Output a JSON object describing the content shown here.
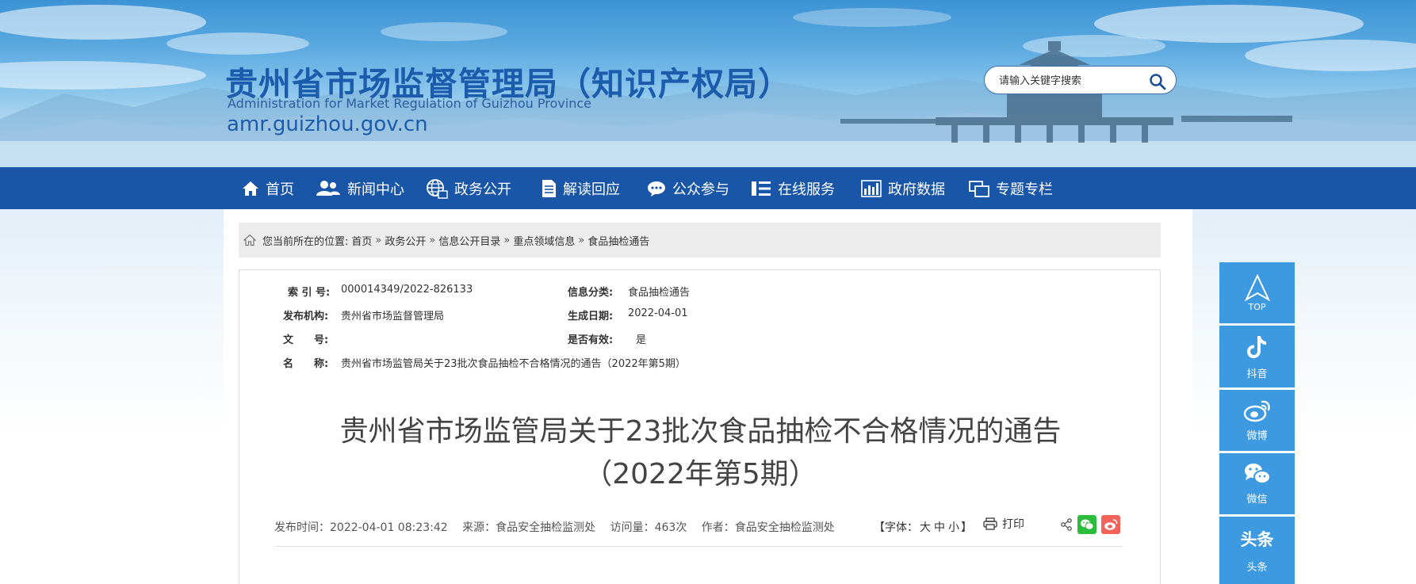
{
  "header": {
    "title": "贵州省市场监督管理局（知识产权局）",
    "subtitle": "Administration for Market Regulation of Guizhou Province",
    "domain": "amr.guizhou.gov.cn",
    "search_placeholder": "请输入关键字搜索",
    "search_icon": "search-icon"
  },
  "nav": {
    "items": [
      {
        "label": "首页",
        "icon": "home-icon"
      },
      {
        "label": "新闻中心",
        "icon": "people-icon"
      },
      {
        "label": "政务公开",
        "icon": "globe-icon"
      },
      {
        "label": "解读回应",
        "icon": "document-icon"
      },
      {
        "label": "公众参与",
        "icon": "chat-icon"
      },
      {
        "label": "在线服务",
        "icon": "list-icon"
      },
      {
        "label": "政府数据",
        "icon": "bar-chart-icon"
      },
      {
        "label": "专题专栏",
        "icon": "window-icon"
      }
    ],
    "bg_color": "#1a56a8"
  },
  "breadcrumb": {
    "prefix": "您当前所在的位置:",
    "items": [
      "首页",
      "政务公开",
      "信息公开目录",
      "重点领域信息",
      "食品抽检通告"
    ],
    "separator": "»"
  },
  "meta": {
    "index_label": "索 引 号:",
    "index_value": "000014349/2022-826133",
    "category_label": "信息分类:",
    "category_value": "食品抽检通告",
    "publisher_label": "发布机构:",
    "publisher_value": "贵州省市场监督管理局",
    "date_label": "生成日期:",
    "date_value": "2022-04-01",
    "docno_label": "文　　号:",
    "docno_value": "",
    "valid_label": "是否有效:",
    "valid_value": "是",
    "name_label": "名　　称:",
    "name_value": "贵州省市场监管局关于23批次食品抽检不合格情况的通告（2022年第5期）"
  },
  "article": {
    "title_line1": "贵州省市场监管局关于23批次食品抽检不合格情况的通告",
    "title_line2": "（2022年第5期）",
    "publish_time": "发布时间：2022-04-01 08:23:42",
    "source": "来源：食品安全抽检监测处",
    "views": "访问量：463次",
    "author": "作者：食品安全抽检监测处",
    "font_prefix": "【字体：",
    "font_large": "大",
    "font_medium": "中",
    "font_small": "小",
    "font_suffix": "】",
    "print_label": "打印"
  },
  "float_bar": {
    "top_label": "TOP",
    "items": [
      {
        "label": "抖音",
        "icon": "tiktok-icon"
      },
      {
        "label": "微博",
        "icon": "weibo-icon"
      },
      {
        "label": "微信",
        "icon": "wechat-icon"
      },
      {
        "label": "头条",
        "icon": "toutiao-icon"
      }
    ],
    "toutiao_mark": "头条",
    "bg_color": "#3d9ae0"
  }
}
